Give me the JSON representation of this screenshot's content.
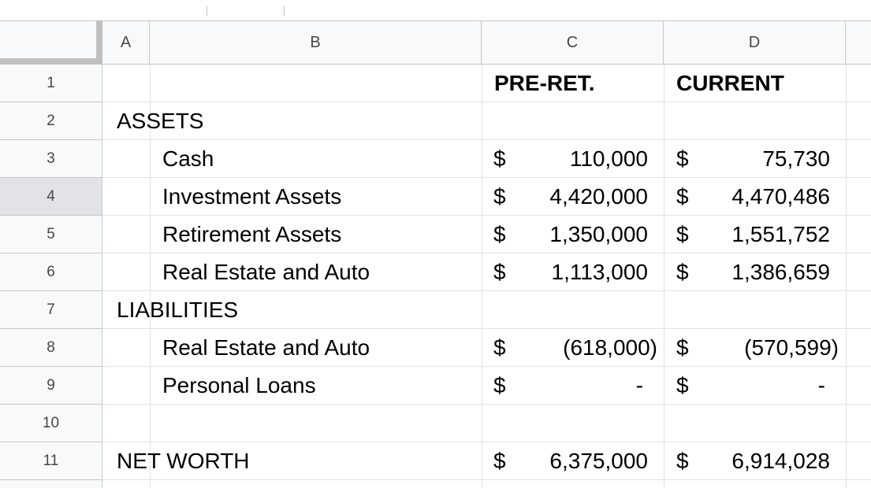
{
  "columns": [
    "A",
    "B",
    "C",
    "D"
  ],
  "rows": [
    {
      "num": "1",
      "b": "",
      "c_sym": "",
      "c_val": "",
      "d_sym": "",
      "d_val": ""
    },
    {
      "num": "2",
      "b": "",
      "c_sym": "",
      "c_val": "",
      "d_sym": "",
      "d_val": ""
    },
    {
      "num": "3",
      "b": "Cash",
      "c_sym": "$",
      "c_val": "110,000",
      "d_sym": "$",
      "d_val": "75,730"
    },
    {
      "num": "4",
      "b": "Investment Assets",
      "c_sym": "$",
      "c_val": "4,420,000",
      "d_sym": "$",
      "d_val": "4,470,486"
    },
    {
      "num": "5",
      "b": "Retirement Assets",
      "c_sym": "$",
      "c_val": "1,350,000",
      "d_sym": "$",
      "d_val": "1,551,752"
    },
    {
      "num": "6",
      "b": "Real Estate and Auto",
      "c_sym": "$",
      "c_val": "1,113,000",
      "d_sym": "$",
      "d_val": "1,386,659"
    },
    {
      "num": "7",
      "b": "",
      "c_sym": "",
      "c_val": "",
      "d_sym": "",
      "d_val": ""
    },
    {
      "num": "8",
      "b": "Real Estate and Auto",
      "c_sym": "$",
      "c_val": "(618,000)",
      "d_sym": "$",
      "d_val": "(570,599)"
    },
    {
      "num": "9",
      "b": "Personal Loans",
      "c_sym": "$",
      "c_val": "-",
      "d_sym": "$",
      "d_val": "-"
    },
    {
      "num": "10",
      "b": "",
      "c_sym": "",
      "c_val": "",
      "d_sym": "",
      "d_val": ""
    },
    {
      "num": "11",
      "b": "",
      "c_sym": "$",
      "c_val": "6,375,000",
      "d_sym": "$",
      "d_val": "6,914,028"
    }
  ],
  "headers": {
    "pre_ret": "PRE-RET.",
    "current": "CURRENT"
  },
  "sections": {
    "assets": "ASSETS",
    "liabilities": "LIABILITIES",
    "net_worth": "NET WORTH"
  },
  "colors": {
    "header_bg": "#f8f9fa",
    "selected_row_header": "#e1e3e6",
    "gridline": "#e2e2e2",
    "freeze_bar": "#c0c0c0"
  }
}
